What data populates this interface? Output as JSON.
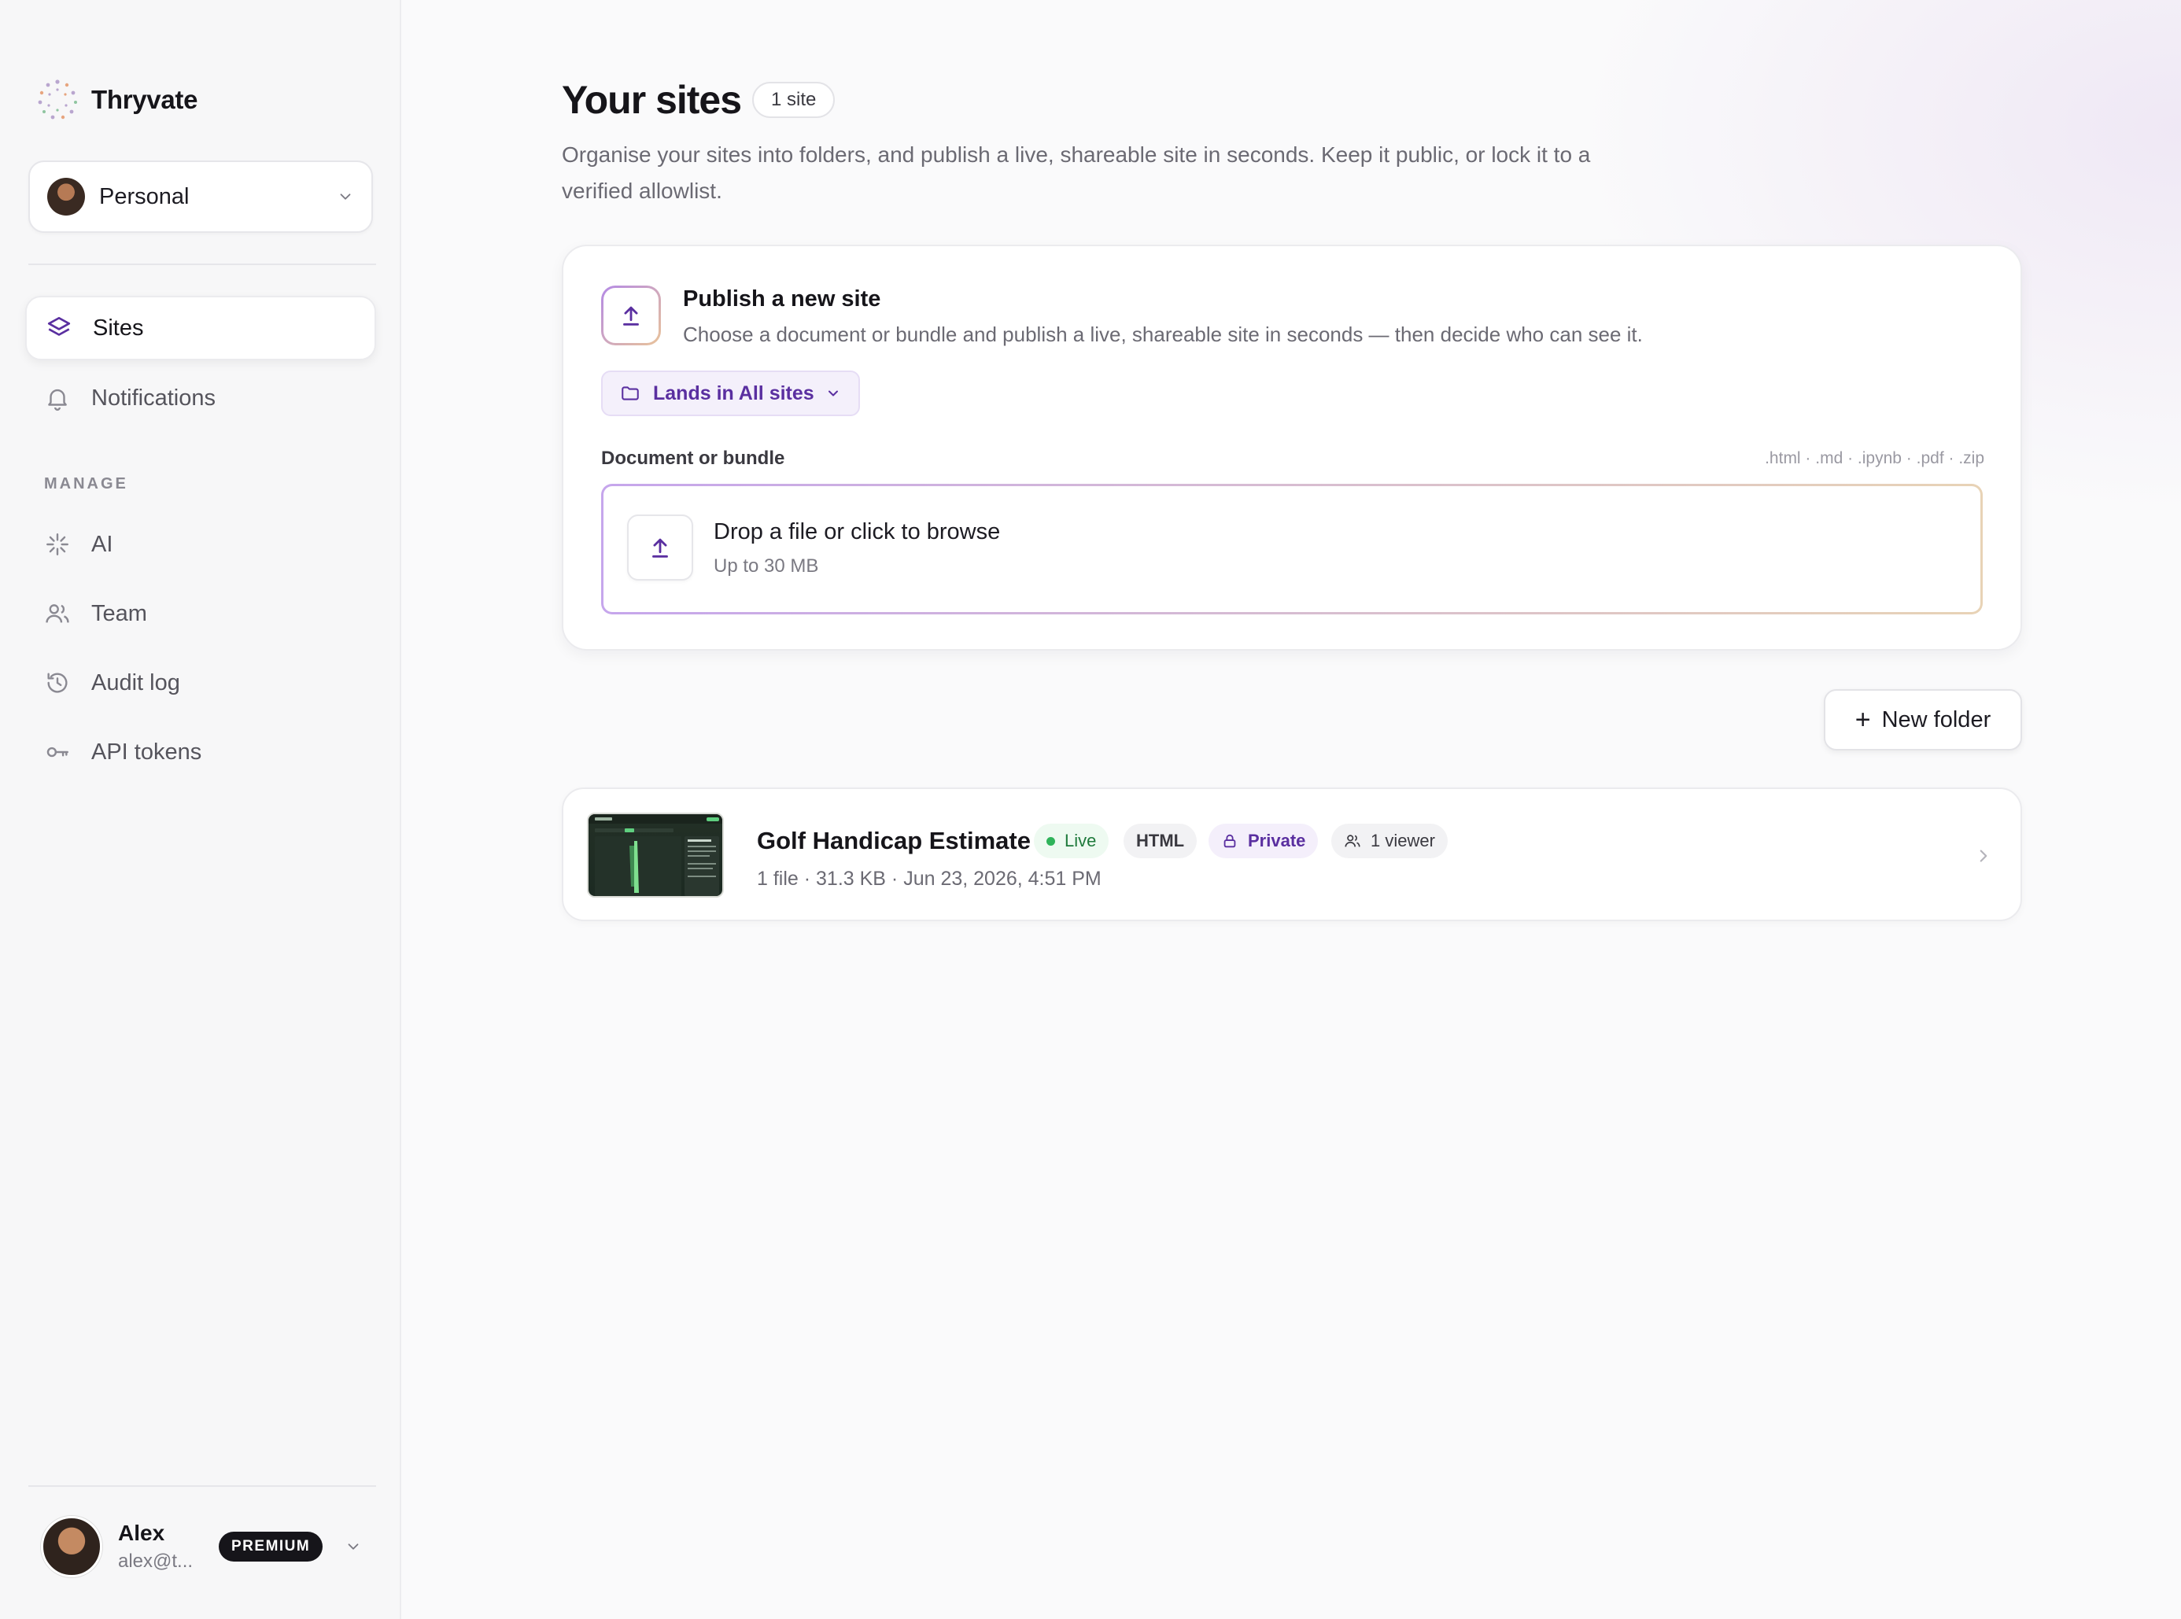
{
  "brand": {
    "name": "Thryvate"
  },
  "workspace": {
    "label": "Personal"
  },
  "nav": {
    "items": [
      {
        "label": "Sites",
        "icon": "layers-icon",
        "active": true
      },
      {
        "label": "Notifications",
        "icon": "bell-icon"
      }
    ],
    "manage_label": "MANAGE",
    "manage_items": [
      {
        "label": "AI",
        "icon": "sparkle-icon"
      },
      {
        "label": "Team",
        "icon": "users-icon"
      },
      {
        "label": "Audit log",
        "icon": "history-icon"
      },
      {
        "label": "API tokens",
        "icon": "key-icon"
      }
    ]
  },
  "account": {
    "name": "Alex",
    "email": "alex@t...",
    "plan": "PREMIUM"
  },
  "header": {
    "title": "Your sites",
    "count": "1 site",
    "description": "Organise your sites into folders, and publish a live, shareable site in seconds. Keep it public, or lock it to a verified allowlist."
  },
  "publish": {
    "title": "Publish a new site",
    "subtitle": "Choose a document or bundle and publish a live, shareable site in seconds — then decide who can see it.",
    "folder_selector": "Lands in All sites",
    "doc_label": "Document or bundle",
    "accepted_types": ".html · .md · .ipynb · .pdf · .zip",
    "dropzone_title": "Drop a file or click to browse",
    "dropzone_sub": "Up to 30 MB"
  },
  "actions": {
    "new_folder": "New folder"
  },
  "sites": [
    {
      "name": "Golf Handicap Estimate",
      "status": "Live",
      "type": "HTML",
      "visibility": "Private",
      "viewers": "1 viewer",
      "meta": "1 file · 31.3 KB · Jun 23, 2026, 4:51 PM"
    }
  ],
  "colors": {
    "accent": "#5a2fa0",
    "live_green": "#2fb35a",
    "text_primary": "#16151a",
    "text_secondary": "#6b6a73"
  }
}
